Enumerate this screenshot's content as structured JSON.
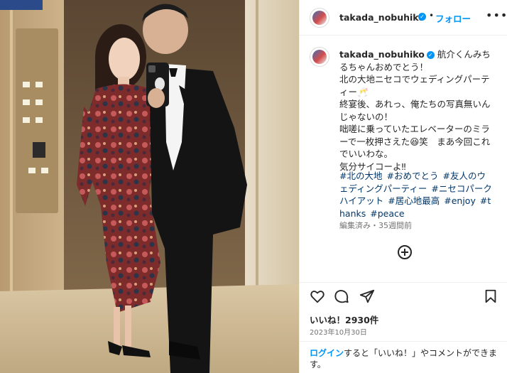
{
  "post": {
    "username": "takada_nobuhiko",
    "follow_label": "フォロー",
    "header_separator": "•",
    "more_label": "•••",
    "caption": "航介くんみちるちゃんおめでとう！\n北の大地ニセコでウェディングパーティー🥂\n終宴後、あれっ、俺たちの写真無いんじゃないの！\n咄嗟に乗っていたエレベーターのミラーで一枚押さえた😆笑　まあ今回これでいいわな。\n気分サイコーよ‼︎",
    "hashtags": [
      "#北の大地",
      "#おめでとう",
      "#友人のウェディングパーティー",
      "#ニセコパークハイアット",
      "#居心地最高",
      "#enjoy",
      "#thanks",
      "#peace"
    ],
    "edited_label": "編集済み・35週間前",
    "likes_label": "いいね！2930件",
    "date_label": "2023年10月30日",
    "login_link": "ログイン",
    "login_text": "すると「いいね！」やコメントができます。",
    "icons": {
      "heart": "heart-icon",
      "comment": "comment-icon",
      "share": "share-icon",
      "save": "bookmark-icon",
      "load_more": "plus-circle-icon",
      "verified": "verified-badge-icon",
      "more": "more-options-icon"
    },
    "colors": {
      "link_blue": "#0095f6",
      "hashtag_blue": "#00376b",
      "verified_blue": "#0095f6",
      "muted": "#737373"
    }
  }
}
